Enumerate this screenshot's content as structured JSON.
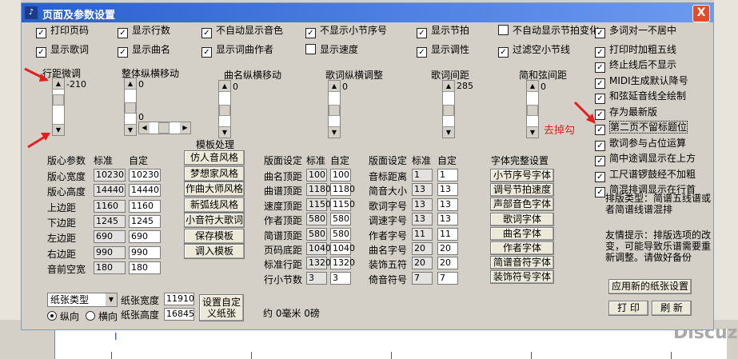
{
  "window": {
    "title": "页面及参数设置",
    "close": "X"
  },
  "checkboxes": [
    {
      "label": "打印页码",
      "checked": true
    },
    {
      "label": "显示行数",
      "checked": true
    },
    {
      "label": "不自动显示音色",
      "checked": true
    },
    {
      "label": "不显示小节序号",
      "checked": true
    },
    {
      "label": "显示节拍",
      "checked": true
    },
    {
      "label": "不自动显示节拍变化",
      "checked": false
    },
    {
      "label": "多词对一不居中",
      "checked": true
    },
    {
      "label": "显示歌词",
      "checked": true
    },
    {
      "label": "显示曲名",
      "checked": true
    },
    {
      "label": "显示词曲作者",
      "checked": true
    },
    {
      "label": "显示速度",
      "checked": false
    },
    {
      "label": "显示调性",
      "checked": true
    },
    {
      "label": "过滤空小节线",
      "checked": true
    },
    {
      "label": "打印时加粗五线",
      "checked": true
    }
  ],
  "right_checkboxes": [
    {
      "label": "终止线后不显示",
      "checked": true
    },
    {
      "label": "MIDI生成默认降号",
      "checked": true
    },
    {
      "label": "和弦延音线全绘制",
      "checked": true
    },
    {
      "label": "存为最新版",
      "checked": true
    },
    {
      "label": "第二页不留标题位",
      "checked": true
    },
    {
      "label": "歌词参与占位运算",
      "checked": true
    },
    {
      "label": "简中途调显示在上方",
      "checked": true
    },
    {
      "label": "工尺谱锣鼓经不加粗",
      "checked": true
    },
    {
      "label": "简混排调显示在行首",
      "checked": true
    }
  ],
  "scrollers": [
    {
      "label": "行距微调",
      "value": "-210"
    },
    {
      "label": "整体纵横移动",
      "value": "0",
      "value2": "0"
    },
    {
      "label": "曲名纵横移动",
      "value": "0"
    },
    {
      "label": "歌词纵横调整",
      "value": "0"
    },
    {
      "label": "歌词间距",
      "value": "285"
    },
    {
      "label": "简和弦间距",
      "value": "0"
    }
  ],
  "template_title": "模板处理",
  "template_buttons": [
    "仿人音风格",
    "梦想家风格",
    "作曲大师风格",
    "新弧线风格",
    "小音符大歌词",
    "保存模板",
    "调入模板"
  ],
  "layout_params": {
    "header": [
      "版心参数",
      "标准",
      "自定"
    ],
    "rows": [
      {
        "label": "版心宽度",
        "std": "10230",
        "custom": "10230"
      },
      {
        "label": "版心高度",
        "std": "14440",
        "custom": "14440"
      },
      {
        "label": "上边距",
        "std": "1160",
        "custom": "1160"
      },
      {
        "label": "下边距",
        "std": "1245",
        "custom": "1245"
      },
      {
        "label": "左边距",
        "std": "690",
        "custom": "690"
      },
      {
        "label": "右边距",
        "std": "990",
        "custom": "990"
      },
      {
        "label": "音前空宽",
        "std": "180",
        "custom": "180"
      }
    ]
  },
  "page_settings1": {
    "header": [
      "版面设定",
      "标准",
      "自定"
    ],
    "rows": [
      {
        "label": "曲名顶距",
        "std": "100",
        "custom": "100"
      },
      {
        "label": "曲谱顶距",
        "std": "1180",
        "custom": "1180"
      },
      {
        "label": "速度顶距",
        "std": "1150",
        "custom": "1150"
      },
      {
        "label": "作者顶距",
        "std": "580",
        "custom": "580"
      },
      {
        "label": "简谱顶距",
        "std": "580",
        "custom": "580"
      },
      {
        "label": "页码底距",
        "std": "1040",
        "custom": "1040"
      },
      {
        "label": "标准行距",
        "std": "1320",
        "custom": "1320"
      },
      {
        "label": "行小节数",
        "std": "3",
        "custom": "3"
      }
    ]
  },
  "page_settings2": {
    "header": [
      "版面设定",
      "标准",
      "自定"
    ],
    "rows": [
      {
        "label": "音标距离",
        "std": "1",
        "custom": "1"
      },
      {
        "label": "简音大小",
        "std": "13",
        "custom": "13"
      },
      {
        "label": "歌词字号",
        "std": "13",
        "custom": "13"
      },
      {
        "label": "调速字号",
        "std": "13",
        "custom": "13"
      },
      {
        "label": "作者字号",
        "std": "11",
        "custom": "11"
      },
      {
        "label": "曲名字号",
        "std": "20",
        "custom": "20"
      },
      {
        "label": "装饰五符",
        "std": "20",
        "custom": "20"
      },
      {
        "label": "倚音符号",
        "std": "7",
        "custom": "7"
      }
    ]
  },
  "font_title": "字体完整设置",
  "font_buttons": [
    "小节序号字体",
    "调号节拍速度",
    "声部音色字体",
    "歌词字体",
    "曲名字体",
    "作者字体",
    "简谱音符字体",
    "装饰符号字体"
  ],
  "paper": {
    "type_label": "纸张类型",
    "width_label": "纸张宽度",
    "width": "11910",
    "height_label": "纸张高度",
    "height": "16845",
    "portrait": "纵向",
    "landscape": "横向",
    "custom_btn": "设置自定义纸张",
    "status": "约 0毫米 0磅"
  },
  "info": "排版类型：简谱五线谱或者简谱线谱混排",
  "tip": "友情提示：排版选项的改变，可能导致乐谱需要重新调整。请做好备份",
  "apply_btn": "应用新的纸张设置",
  "print_btn": "打 印",
  "refresh_btn": "刷 新",
  "annotation": "去掉勾",
  "watermark": "Discuz!"
}
